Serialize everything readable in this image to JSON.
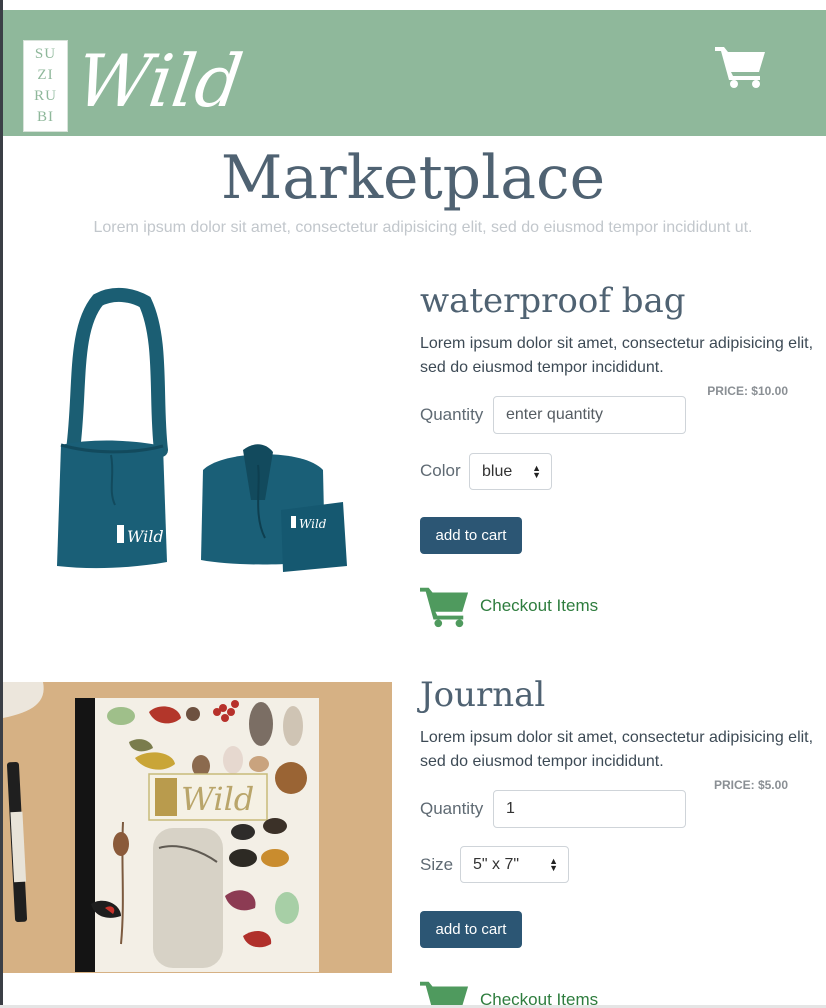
{
  "header": {
    "logo_letters": [
      "SU",
      "ZI",
      "RU",
      "BI"
    ],
    "logo_word": "Wild",
    "cart_icon": "shopping-cart-icon",
    "background_color": "#8fb89b"
  },
  "page": {
    "title": "Marketplace",
    "subtitle": "Lorem ipsum dolor sit amet, consectetur adipisicing elit, sed do eiusmod tempor incididunt ut."
  },
  "products": [
    {
      "title": "waterproof bag",
      "description": "Lorem ipsum dolor sit amet, consectetur adipisicing elit, sed do eiusmod tempor incididunt.",
      "price": "PRICE: $10.00",
      "quantity_label": "Quantity",
      "quantity_value": "",
      "quantity_placeholder": "enter quantity",
      "option_label": "Color",
      "option_value": "blue",
      "add_button": "add to cart",
      "checkout_label": "Checkout Items",
      "image_logo_word": "Wild"
    },
    {
      "title": "Journal",
      "description": "Lorem ipsum dolor sit amet, consectetur adipisicing elit, sed do eiusmod tempor incididunt.",
      "price": "PRICE: $5.00",
      "quantity_label": "Quantity",
      "quantity_value": "1",
      "quantity_placeholder": "",
      "option_label": "Size",
      "option_value": "5\" x 7\"",
      "add_button": "add to cart",
      "checkout_label": "Checkout Items",
      "image_logo_word": "Wild"
    }
  ],
  "colors": {
    "button": "#2c5674",
    "checkout_green": "#2e7d3e",
    "title": "#4f6272"
  }
}
